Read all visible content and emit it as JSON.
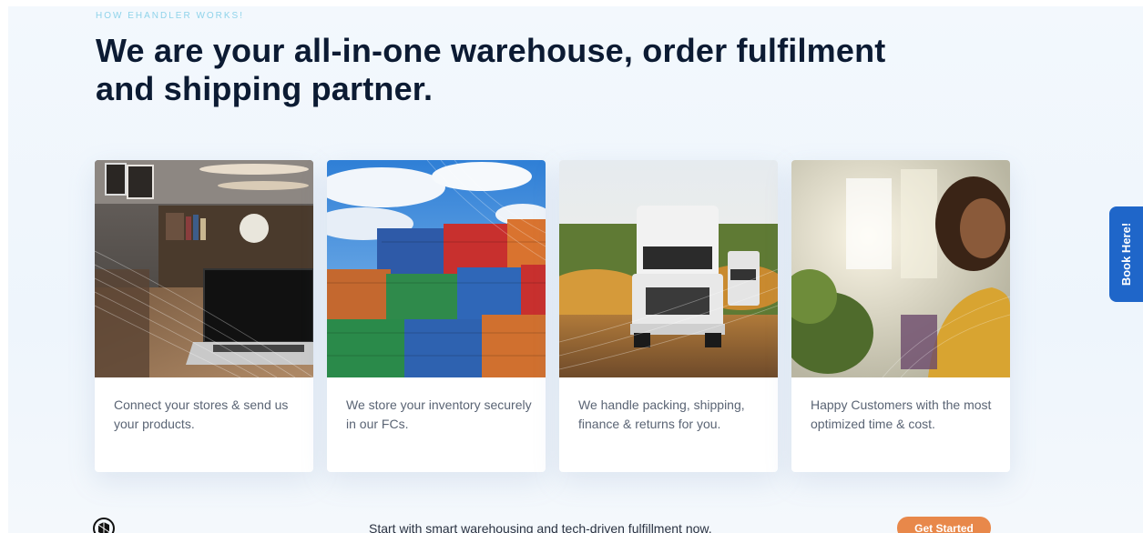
{
  "section": {
    "eyebrow": "HOW EHANDLER WORKS!",
    "headline": "We are your all-in-one warehouse, order fulfilment and shipping partner."
  },
  "cards": [
    {
      "image": "laptop-on-desk-photo",
      "caption": "Connect your stores & send us your products."
    },
    {
      "image": "shipping-containers-photo",
      "caption": "We store your inventory securely in our FCs."
    },
    {
      "image": "delivery-trucks-photo",
      "caption": "We handle packing, shipping, finance & returns for you."
    },
    {
      "image": "smiling-customer-photo",
      "caption": "Happy Customers with the most optimized time & cost."
    }
  ],
  "side_tab": {
    "label": "Book Here!",
    "color": "#1f66c9"
  },
  "bottom_bar": {
    "logo_icon": "ehandler-logo-icon",
    "text": "Start with smart warehousing and tech-driven fulfillment now.",
    "cta_label": "Get Started",
    "cta_color": "#e8884a"
  }
}
